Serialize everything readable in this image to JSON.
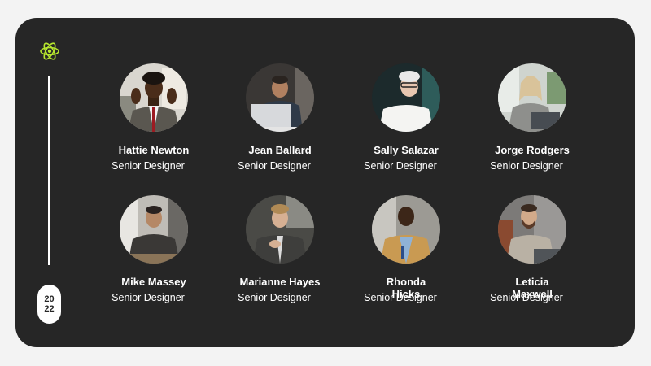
{
  "accent_color": "#b6e62e",
  "year": {
    "line1": "20",
    "line2": "22"
  },
  "members": [
    {
      "name": "Hattie Newton",
      "role": "Senior Designer"
    },
    {
      "name": "Jean Ballard",
      "role": "Senior Designer"
    },
    {
      "name": "Sally Salazar",
      "role": "Senior Designer"
    },
    {
      "name": "Jorge Rodgers",
      "role": "Senior Designer"
    },
    {
      "name": "Mike Massey",
      "role": "Senior Designer"
    },
    {
      "name": "Marianne Hayes",
      "role": "Senior Designer"
    },
    {
      "name": "Rhonda Hicks",
      "role": "Senior Designer"
    },
    {
      "name": "Leticia Maxwell",
      "role": "Senior Designer"
    }
  ]
}
